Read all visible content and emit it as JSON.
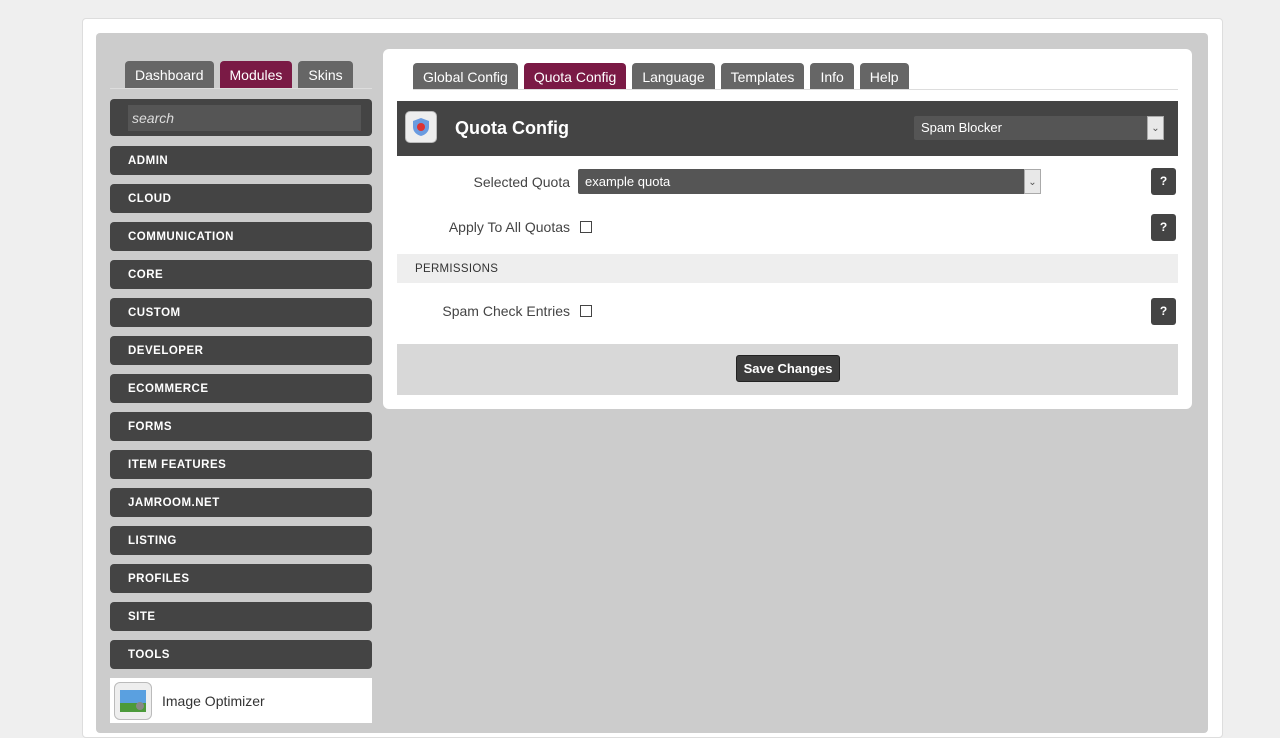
{
  "left_tabs": [
    "Dashboard",
    "Modules",
    "Skins"
  ],
  "search": {
    "placeholder": "search"
  },
  "categories": [
    "ADMIN",
    "CLOUD",
    "COMMUNICATION",
    "CORE",
    "CUSTOM",
    "DEVELOPER",
    "ECOMMERCE",
    "FORMS",
    "ITEM FEATURES",
    "JAMROOM.NET",
    "LISTING",
    "PROFILES",
    "SITE",
    "TOOLS"
  ],
  "module_item": "Image Optimizer",
  "right_tabs": [
    "Global Config",
    "Quota Config",
    "Language",
    "Templates",
    "Info",
    "Help"
  ],
  "header": {
    "title": "Quota Config",
    "module_select": "Spam Blocker"
  },
  "fields": {
    "selected_quota_label": "Selected Quota",
    "selected_quota_value": "example quota",
    "apply_all_label": "Apply To All Quotas",
    "spam_check_label": "Spam Check Entries",
    "help": "?"
  },
  "section": "PERMISSIONS",
  "save_label": "Save Changes",
  "colors": {
    "accent": "#7a1a45",
    "dark": "#444444"
  }
}
